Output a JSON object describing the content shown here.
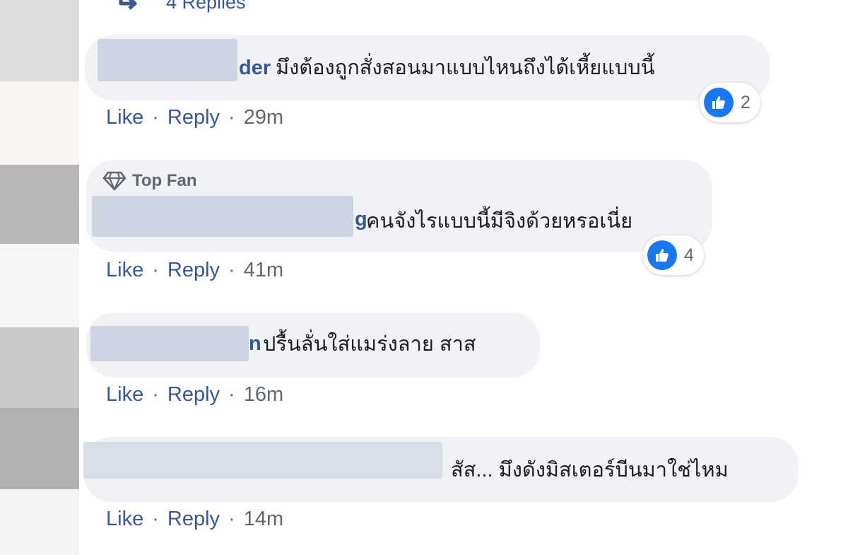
{
  "thread": {
    "replies_label": "4 Replies"
  },
  "comments": [
    {
      "author_visible": "der",
      "text": "มึงต้องถูกสั่งสอนมาแบบไหนถึงได้เหี้ยแบบนี้",
      "reaction_count": "2",
      "actions": {
        "like": "Like",
        "reply": "Reply",
        "time": "29m"
      }
    },
    {
      "badge": "Top Fan",
      "author_visible": "g",
      "text": "คนจังไรแบบนี้มีจิงด้วยหรอเนี่ย",
      "reaction_count": "4",
      "actions": {
        "like": "Like",
        "reply": "Reply",
        "time": "41m"
      }
    },
    {
      "author_visible": "n",
      "text": "ปรื้นลั่นใส่แมร่งลาย สาส",
      "actions": {
        "like": "Like",
        "reply": "Reply",
        "time": "16m"
      }
    },
    {
      "author_visible": "",
      "text": "สัส... มึงดังมิสเตอร์บีนมาใช่ไหม",
      "actions": {
        "like": "Like",
        "reply": "Reply",
        "time": "14m"
      }
    }
  ],
  "separator": "·",
  "colors": {
    "link": "#385898",
    "bubble": "#f0f2f5",
    "like_blue": "#1877f2",
    "meta_gray": "#606770"
  },
  "icons": {
    "reply_arrow": "reply-arrow-icon",
    "top_fan": "diamond-icon",
    "like": "thumbs-up-icon"
  }
}
